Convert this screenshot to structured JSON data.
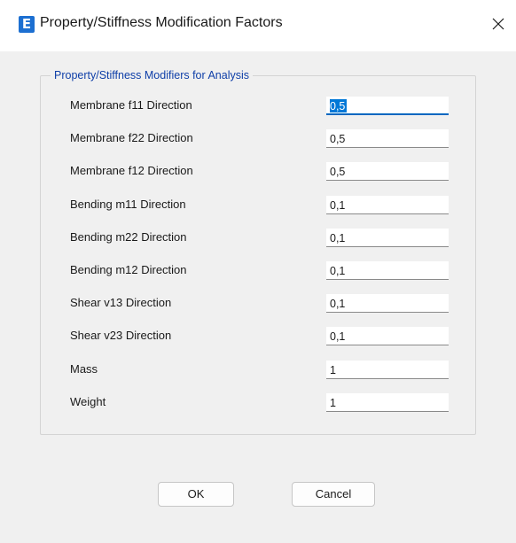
{
  "window": {
    "app_icon_letter": "E",
    "title": "Property/Stiffness Modification Factors",
    "close_glyph": "✕"
  },
  "group": {
    "title": "Property/Stiffness Modifiers for Analysis"
  },
  "modifiers": [
    {
      "label": "Membrane f11 Direction",
      "value": "0,5",
      "focused": true
    },
    {
      "label": "Membrane f22 Direction",
      "value": "0,5"
    },
    {
      "label": "Membrane f12 Direction",
      "value": "0,5"
    },
    {
      "label": "Bending m11 Direction",
      "value": "0,1"
    },
    {
      "label": "Bending m22 Direction",
      "value": "0,1"
    },
    {
      "label": "Bending m12 Direction",
      "value": "0,1"
    },
    {
      "label": "Shear v13 Direction",
      "value": "0,1"
    },
    {
      "label": "Shear v23 Direction",
      "value": "0,1"
    },
    {
      "label": "Mass",
      "value": "1"
    },
    {
      "label": "Weight",
      "value": "1"
    }
  ],
  "buttons": {
    "ok_label": "OK",
    "cancel_label": "Cancel"
  },
  "colors": {
    "accent": "#0067c0",
    "group_title": "#0f3fa8",
    "app_icon": "#1c6fd1"
  }
}
